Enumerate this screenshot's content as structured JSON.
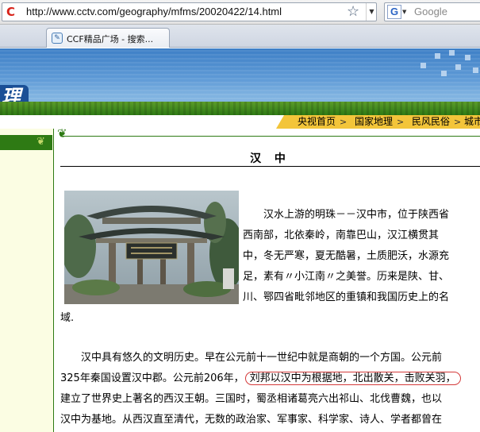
{
  "browser": {
    "url": "http://www.cctv.com/geography/mfms/20020422/14.html",
    "search_placeholder": "Google",
    "search_engine_icon_letter": "G",
    "tab_title": "CCF精品广场 - 搜索..."
  },
  "site": {
    "logo_fragment": "理",
    "breadcrumb": [
      "央视首页",
      "国家地理",
      "民风民俗",
      "城市"
    ],
    "breadcrumb_separator": ">"
  },
  "article": {
    "title": "汉 中",
    "paragraph1_lines": [
      "汉水上游的明珠－－汉中市，位于陕西省",
      "西南部，北依秦岭，南靠巴山，汉江横贯其",
      "中，冬无严寒，夏无酷暑，土质肥沃，水源充",
      "足，素有〃小江南〃之美誉。历来是陕、甘、",
      "川、鄂四省毗邻地区的重镇和我国历史上的名",
      "域."
    ],
    "paragraph2_line1": "汉中具有悠久的文明历史。早在公元前十一世纪中就是商朝的一个方国。公元前",
    "paragraph2_line2_before": "325年秦国设置汉中郡。公元前206年，",
    "paragraph2_line2_highlight": "刘邦以汉中为根据地，北出散关，击败关羽，",
    "paragraph2_line3": "建立了世界史上著名的西汉王朝。三国时，蜀丞相诸葛亮六出祁山、北伐曹魏，也以",
    "paragraph2_line4": "汉中为基地。从西汉直至清代，无数的政治家、军事家、科学家、诗人、学者都曾在"
  },
  "colors": {
    "banner_blue": "#3d7fc6",
    "grass_green": "#2e7a14",
    "breadcrumb_yellow": "#f3c53a",
    "left_panel": "#fbfde3",
    "highlight_red": "#d43a3a"
  }
}
